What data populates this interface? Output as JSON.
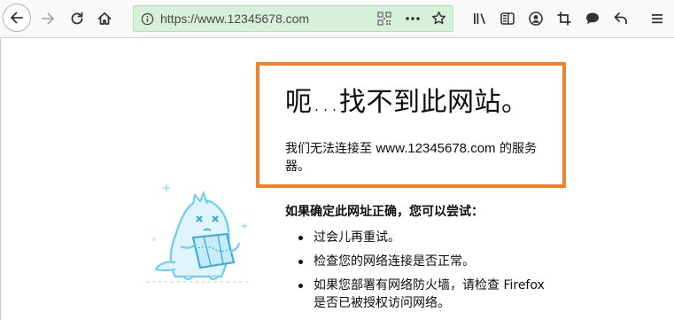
{
  "toolbar": {
    "url": "https://www.12345678.com",
    "icons": {
      "back": "back-arrow-icon",
      "forward": "forward-arrow-icon",
      "reload": "reload-icon",
      "home": "home-icon",
      "info": "info-icon",
      "qr": "qr-code-icon",
      "more": "more-dots-icon",
      "bookmark": "star-icon",
      "library": "library-icon",
      "sidebar": "sidebar-icon",
      "account": "account-icon",
      "screenshot": "crop-icon",
      "chat": "chat-bubble-icon",
      "undo": "undo-arrow-icon",
      "menu": "hamburger-menu-icon"
    }
  },
  "error": {
    "title": "呃…找不到此网站。",
    "desc_prefix": "我们无法连接至 ",
    "desc_domain": "www.12345678.com",
    "desc_suffix": " 的服务器。",
    "try_title": "如果确定此网址正确，您可以尝试：",
    "suggestions": [
      "过会儿再重试。",
      "检查您的网络连接是否正常。",
      "如果您部署有网络防火墙，请检查 Firefox 是否已被授权访问网络。"
    ]
  },
  "colors": {
    "highlight": "#f5822a",
    "urlbar_bg": "#d6f0d9",
    "mascot": "#6bcdf2"
  }
}
